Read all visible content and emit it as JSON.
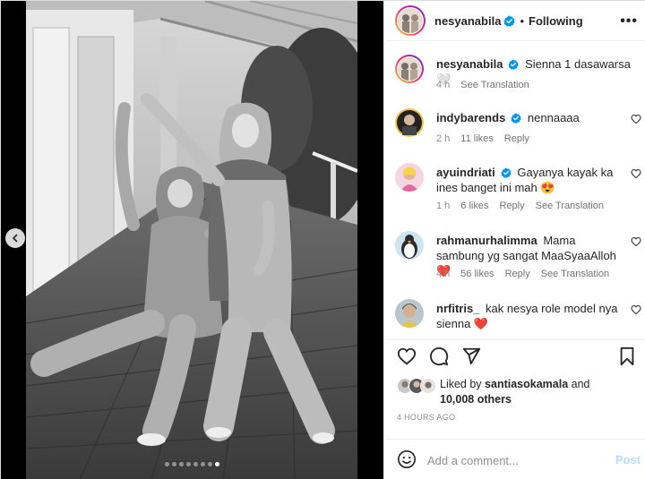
{
  "post": {
    "author": "nesyanabila",
    "follow_separator": "•",
    "follow_state": "Following",
    "more_icon": "more-horizontal-icon",
    "verified_color": "#0095f6",
    "carousel": {
      "total": 8,
      "current": 8
    }
  },
  "caption": {
    "username": "nesyanabila",
    "text": "Sienna 1 dasawarsa 🤍",
    "time": "4 h",
    "see_translation": "See Translation"
  },
  "comments": [
    {
      "username": "indybarends",
      "verified": true,
      "text": "nennaaaa",
      "time": "2 h",
      "likes": "11 likes",
      "reply": "Reply",
      "see_translation": ""
    },
    {
      "username": "ayuindriati",
      "verified": true,
      "text": "Gayanya kayak ka ines banget ini mah 😍",
      "time": "1 h",
      "likes": "6 likes",
      "reply": "Reply",
      "see_translation": "See Translation"
    },
    {
      "username": "rahmanurhalimma",
      "verified": false,
      "text": "Mama sambung yg sangat MaaSyaaAlloh ❤️",
      "time": "4 h",
      "likes": "56 likes",
      "reply": "Reply",
      "see_translation": "See Translation"
    },
    {
      "username": "nrfitris_",
      "verified": false,
      "text": "kak nesya role model nya sienna ❤️",
      "time": "",
      "likes": "",
      "reply": "",
      "see_translation": ""
    }
  ],
  "actions": {
    "like_icon": "heart-icon",
    "comment_icon": "comment-icon",
    "share_icon": "send-icon",
    "save_icon": "bookmark-icon"
  },
  "likes": {
    "prefix": "Liked by",
    "user": "santiasokamala",
    "and": "and",
    "others": "10,008 others"
  },
  "timestamp": "4 HOURS AGO",
  "add_comment": {
    "placeholder": "Add a comment...",
    "post_label": "Post",
    "emoji_icon": "smiley-icon"
  }
}
